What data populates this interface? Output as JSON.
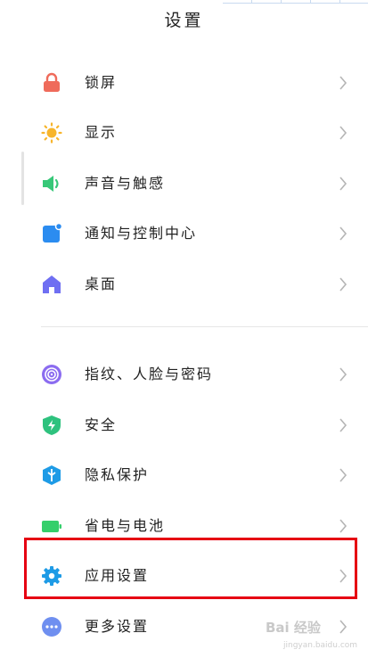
{
  "header": {
    "title": "设置"
  },
  "group1": [
    {
      "id": "lock",
      "label": "锁屏",
      "icon": "lock-icon",
      "color": "#ef6b5b"
    },
    {
      "id": "display",
      "label": "显示",
      "icon": "sun-icon",
      "color": "#f7b52c"
    },
    {
      "id": "sound",
      "label": "声音与触感",
      "icon": "speaker-icon",
      "color": "#37c878"
    },
    {
      "id": "notifications",
      "label": "通知与控制中心",
      "icon": "notification-icon",
      "color": "#2b8cf0"
    },
    {
      "id": "home",
      "label": "桌面",
      "icon": "home-icon",
      "color": "#6f6ff2"
    }
  ],
  "group2": [
    {
      "id": "fingerprint",
      "label": "指纹、人脸与密码",
      "icon": "fingerprint-icon",
      "color": "#8b6cf0"
    },
    {
      "id": "security",
      "label": "安全",
      "icon": "shield-icon",
      "color": "#2ec27e"
    },
    {
      "id": "privacy",
      "label": "隐私保护",
      "icon": "privacy-icon",
      "color": "#1e9be6"
    },
    {
      "id": "battery",
      "label": "省电与电池",
      "icon": "battery-icon",
      "color": "#35cf6b"
    },
    {
      "id": "apps",
      "label": "应用设置",
      "icon": "gear-icon",
      "color": "#1e9be6"
    },
    {
      "id": "more",
      "label": "更多设置",
      "icon": "more-icon",
      "color": "#6f8ff0"
    }
  ],
  "watermark": {
    "line1": "Bai 经验",
    "line2": "jingyan.baidu.com"
  },
  "colors": {
    "highlight": "#e60012",
    "chevron": "#b5b5b5"
  }
}
